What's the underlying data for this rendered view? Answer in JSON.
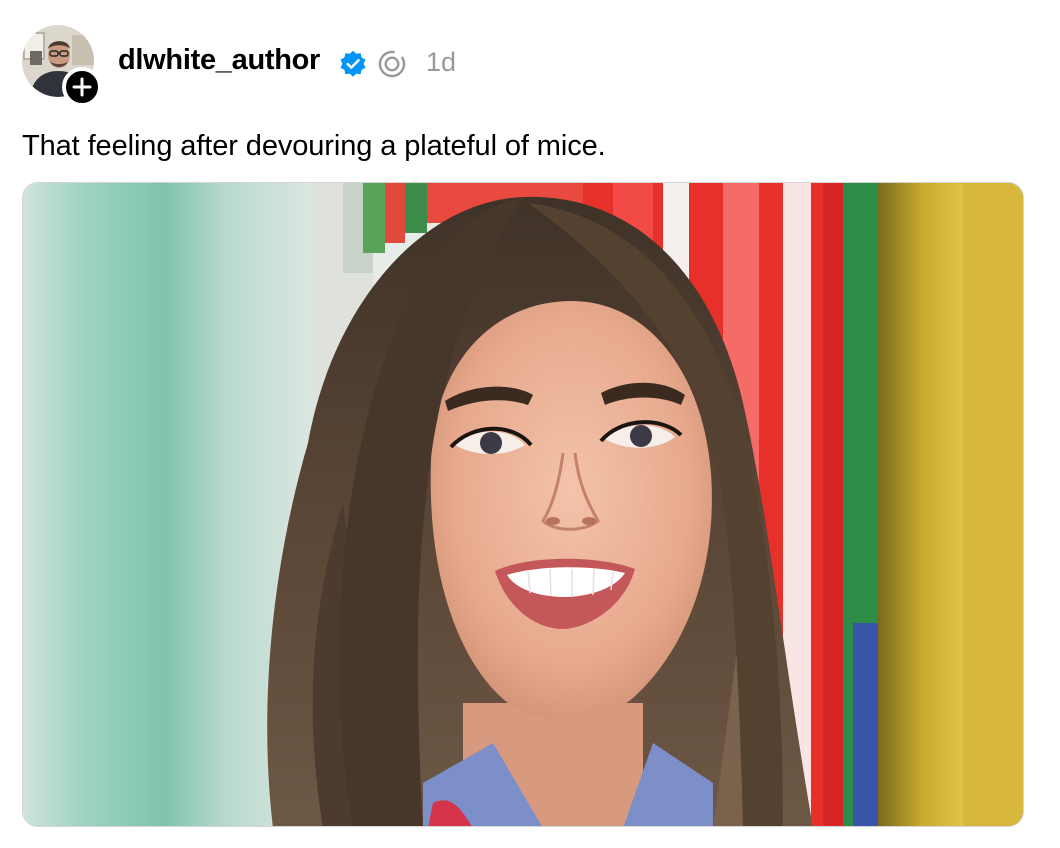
{
  "post": {
    "author": {
      "username": "dlwhite_author",
      "verified": true,
      "avatar_icon": "author-avatar-photo",
      "follow_icon": "plus-icon"
    },
    "timestamp": "1d",
    "text": "That feeling after devouring a plateful of mice.",
    "media": {
      "type": "photo",
      "icon": "photo-smiling-woman"
    }
  },
  "colors": {
    "verified_blue": "#0095f6",
    "timestamp_gray": "#999999",
    "border_gray": "#d4d4d4"
  }
}
